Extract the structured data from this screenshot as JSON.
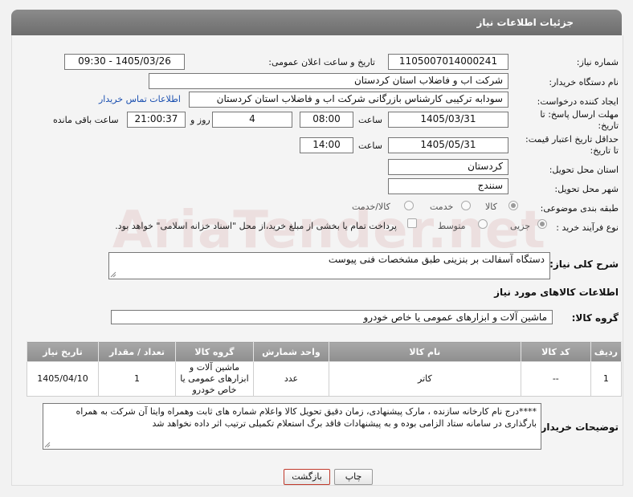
{
  "page_title": "جزئیات اطلاعات نیاز",
  "fields": {
    "need_number": {
      "label": "شماره نیاز:",
      "value": "1105007014000241"
    },
    "announce_datetime": {
      "label": "تاریخ و ساعت اعلان عمومی:",
      "value": "1405/03/26 - 09:30"
    },
    "buyer_org": {
      "label": "نام دستگاه خریدار:",
      "value": "شرکت اب و فاضلاب استان کردستان"
    },
    "requester": {
      "label": "ایجاد کننده درخواست:",
      "value": "سودابه ترکیبی کارشناس بازرگانی شرکت اب و فاضلاب استان کردستان"
    },
    "buyer_contact_link": "اطلاعات تماس خریدار",
    "reply_deadline": {
      "label": "مهلت ارسال پاسخ: تا تاریخ:",
      "date": "1405/03/31",
      "time_label": "ساعت",
      "time": "08:00",
      "days": "4",
      "days_label": "روز و",
      "remaining": "21:00:37",
      "remaining_label": "ساعت باقی مانده"
    },
    "price_validity": {
      "label": "حداقل تاریخ اعتبار قیمت: تا تاریخ:",
      "date": "1405/05/31",
      "time_label": "ساعت",
      "time": "14:00"
    },
    "delivery_province": {
      "label": "استان محل تحویل:",
      "value": "کردستان"
    },
    "delivery_city": {
      "label": "شهر محل تحویل:",
      "value": "سنندج"
    },
    "category": {
      "label": "طبقه بندی موضوعی:",
      "options": [
        "کالا",
        "خدمت",
        "کالا/خدمت"
      ],
      "selected": "کالا"
    },
    "process_type": {
      "label": "نوع فرآیند خرید :",
      "options": [
        "جزیی",
        "متوسط"
      ],
      "selected": "جزیی",
      "payment_note": "پرداخت تمام یا بخشی از مبلغ خرید،از محل \"اسناد خزانه اسلامی\" خواهد بود."
    }
  },
  "description": {
    "label": "شرح کلی نیاز:",
    "value": "دستگاه آسفالت بر بنزینی طبق مشخصات فنی پیوست"
  },
  "goods_section_title": "اطلاعات کالاهای مورد نیاز",
  "goods_group": {
    "label": "گروه کالا:",
    "value": "ماشین آلات و ابزارهای عمومی یا خاص خودرو"
  },
  "table": {
    "headers": [
      "ردیف",
      "کد کالا",
      "نام کالا",
      "واحد شمارش",
      "گروه کالا",
      "تعداد / مقدار",
      "تاریخ نیاز"
    ],
    "rows": [
      [
        "1",
        "--",
        "کاتر",
        "عدد",
        "ماشین آلات و ابزارهای عمومی یا خاص خودرو",
        "1",
        "1405/04/10"
      ]
    ]
  },
  "buyer_notes": {
    "label": "توضیحات خریدار:",
    "value": "****درج نام کارخانه سازنده ، مارک پیشنهادی، زمان دقیق تحویل کالا واعلام شماره های ثابت وهمراه وایتا آن شرکت به همراه بارگذاری در سامانه ستاد الزامی بوده و به پیشنهادات فاقد برگ استعلام تکمیلی ترتیب اثر داده نخواهد شد"
  },
  "buttons": {
    "print": "چاپ",
    "back": "بازگشت"
  },
  "watermark": "AriaTender.net",
  "colors": {
    "header": "#7a7a7a",
    "link": "#1a4fb0",
    "back_button_border": "#c0392b"
  }
}
